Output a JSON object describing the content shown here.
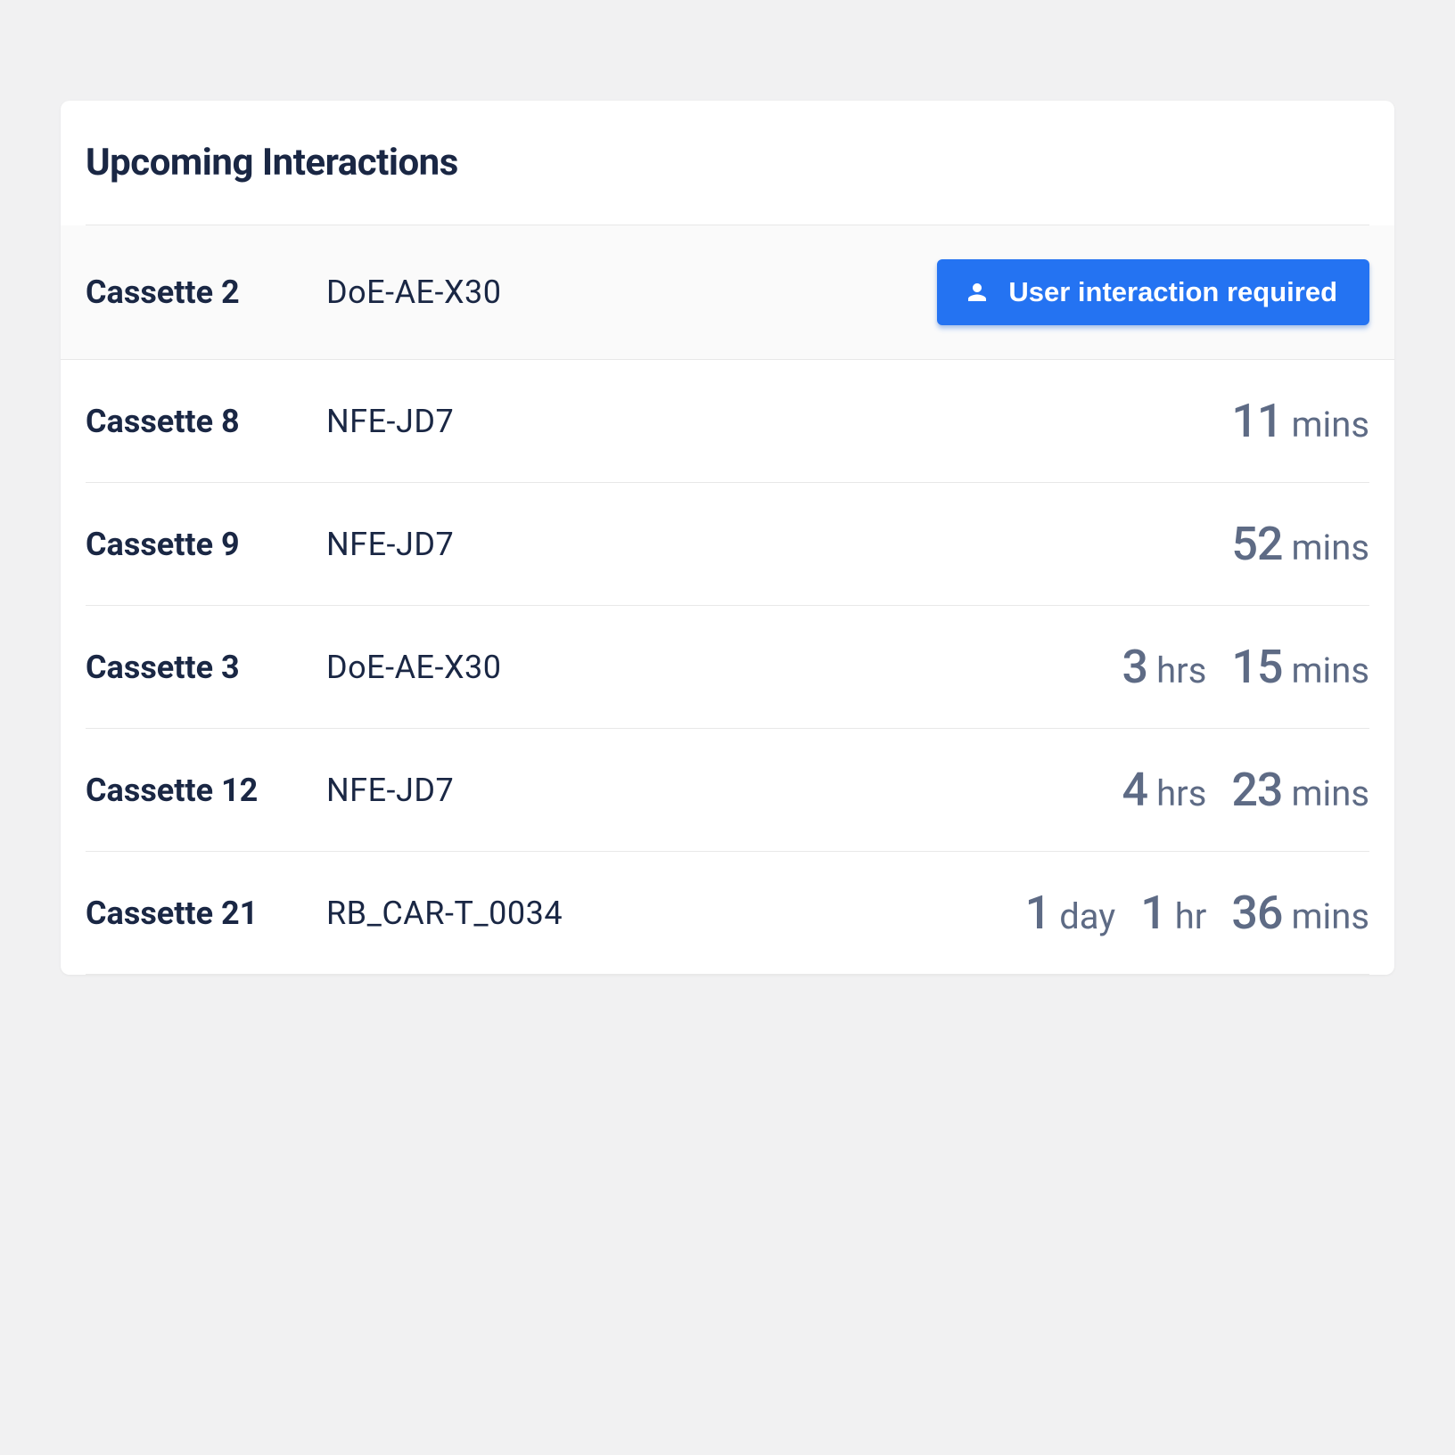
{
  "header": {
    "title": "Upcoming Interactions"
  },
  "action": {
    "label": "User interaction required"
  },
  "rows": [
    {
      "cassette": "Cassette 2",
      "code": "DoE-AE-X30",
      "time": []
    },
    {
      "cassette": "Cassette 8",
      "code": "NFE-JD7",
      "time": [
        {
          "val": "11",
          "unit": "mins"
        }
      ]
    },
    {
      "cassette": "Cassette 9",
      "code": "NFE-JD7",
      "time": [
        {
          "val": "52",
          "unit": "mins"
        }
      ]
    },
    {
      "cassette": "Cassette 3",
      "code": "DoE-AE-X30",
      "time": [
        {
          "val": "3",
          "unit": "hrs"
        },
        {
          "val": "15",
          "unit": "mins"
        }
      ]
    },
    {
      "cassette": "Cassette 12",
      "code": "NFE-JD7",
      "time": [
        {
          "val": "4",
          "unit": "hrs"
        },
        {
          "val": "23",
          "unit": "mins"
        }
      ]
    },
    {
      "cassette": "Cassette 21",
      "code": "RB_CAR-T_0034",
      "time": [
        {
          "val": "1",
          "unit": "day"
        },
        {
          "val": "1",
          "unit": "hr"
        },
        {
          "val": "36",
          "unit": "mins"
        }
      ]
    }
  ]
}
